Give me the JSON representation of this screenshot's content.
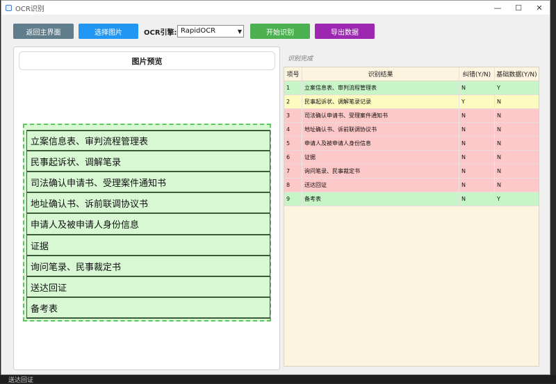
{
  "window": {
    "title": "OCR识别"
  },
  "toolbar": {
    "back_label": "返回主界面",
    "select_label": "选择图片",
    "engine_label": "OCR引擎:",
    "engine_value": "RapidOCR",
    "start_label": "开始识别",
    "export_label": "导出数据"
  },
  "preview": {
    "title": "图片预览",
    "doc_lines": [
      "立案信息表、审判流程管理表",
      "民事起诉状、调解笔录",
      "司法确认申请书、受理案件通知书",
      " 地址确认书、诉前联调协议书",
      "申请人及被申请人身份信息",
      "证据",
      "询问笔录、民事裁定书",
      "送达回证",
      "备考表"
    ]
  },
  "results": {
    "status": "识别完成",
    "headers": [
      "项号",
      "识别结果",
      "纠错(Y/N)",
      "基础数据(Y/N)"
    ],
    "rows": [
      {
        "no": "1",
        "text": "立案信息表、审判流程管理表",
        "corr": "N",
        "base": "Y",
        "status": "green"
      },
      {
        "no": "2",
        "text": "民事起诉状、调解笔录记录",
        "corr": "Y",
        "base": "N",
        "status": "yellow"
      },
      {
        "no": "3",
        "text": "司法确认申请书、受理案件通知书",
        "corr": "N",
        "base": "N",
        "status": "red"
      },
      {
        "no": "4",
        "text": "地址确认书、诉前联调协议书",
        "corr": "N",
        "base": "N",
        "status": "red"
      },
      {
        "no": "5",
        "text": "申请人及被申请人身份信息",
        "corr": "N",
        "base": "N",
        "status": "red"
      },
      {
        "no": "6",
        "text": "证据",
        "corr": "N",
        "base": "N",
        "status": "red"
      },
      {
        "no": "7",
        "text": "询问笔录、民事裁定书",
        "corr": "N",
        "base": "N",
        "status": "red"
      },
      {
        "no": "8",
        "text": "送达回证",
        "corr": "N",
        "base": "N",
        "status": "red"
      },
      {
        "no": "9",
        "text": "备考表",
        "corr": "N",
        "base": "Y",
        "status": "green"
      }
    ]
  },
  "desktop": {
    "bottom_text": "送达回证"
  }
}
